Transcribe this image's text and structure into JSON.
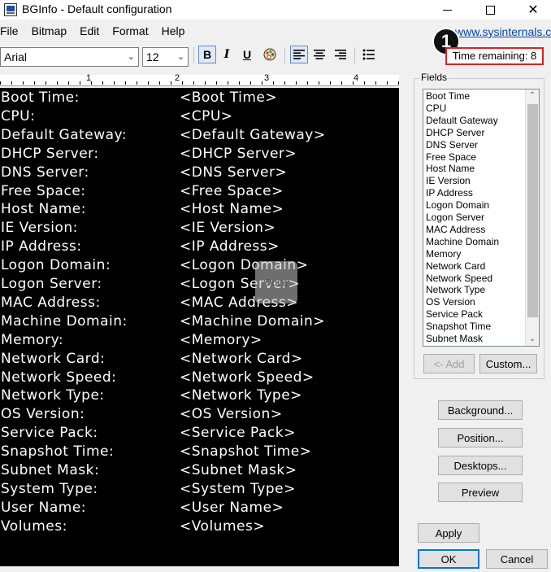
{
  "window": {
    "title": "BGInfo - Default configuration",
    "minimize": "–",
    "maximize": "□",
    "close": "✕"
  },
  "menu": [
    "File",
    "Bitmap",
    "Edit",
    "Format",
    "Help"
  ],
  "link": "www.sysinternals.com",
  "marker": "1",
  "timer": "Time remaining: 8",
  "toolbar": {
    "font": "Arial",
    "size": "12",
    "bold": "B",
    "italic": "𝘐",
    "underline": "U",
    "color": "🎨",
    "align_left": "≡",
    "align_center": "≡",
    "align_right": "≡",
    "bullets": "☰"
  },
  "ruler": [
    "1",
    "2",
    "3",
    "4"
  ],
  "editor_rows": [
    {
      "label": "Boot Time:",
      "value": "<Boot Time>"
    },
    {
      "label": "CPU:",
      "value": "<CPU>"
    },
    {
      "label": "Default Gateway:",
      "value": "<Default Gateway>"
    },
    {
      "label": "DHCP Server:",
      "value": "<DHCP Server>"
    },
    {
      "label": "DNS Server:",
      "value": "<DNS Server>"
    },
    {
      "label": "Free Space:",
      "value": "<Free Space>"
    },
    {
      "label": "Host Name:",
      "value": "<Host Name>"
    },
    {
      "label": "IE Version:",
      "value": "<IE Version>"
    },
    {
      "label": "IP Address:",
      "value": "<IP Address>"
    },
    {
      "label": "Logon Domain:",
      "value": "<Logon Domain>"
    },
    {
      "label": "Logon Server:",
      "value": "<Logon Server>"
    },
    {
      "label": "MAC Address:",
      "value": "<MAC Address>"
    },
    {
      "label": "Machine Domain:",
      "value": "<Machine Domain>"
    },
    {
      "label": "Memory:",
      "value": "<Memory>"
    },
    {
      "label": "Network Card:",
      "value": "<Network Card>"
    },
    {
      "label": "Network Speed:",
      "value": "<Network Speed>"
    },
    {
      "label": "Network Type:",
      "value": "<Network Type>"
    },
    {
      "label": "OS Version:",
      "value": "<OS Version>"
    },
    {
      "label": "Service Pack:",
      "value": "<Service Pack>"
    },
    {
      "label": "Snapshot Time:",
      "value": "<Snapshot Time>"
    },
    {
      "label": "Subnet Mask:",
      "value": "<Subnet Mask>"
    },
    {
      "label": "System Type:",
      "value": "<System Type>"
    },
    {
      "label": "User Name:",
      "value": "<User Name>"
    },
    {
      "label": "Volumes:",
      "value": "<Volumes>"
    }
  ],
  "watermark": "Dove",
  "fields": {
    "title": "Fields",
    "items": [
      "Boot Time",
      "CPU",
      "Default Gateway",
      "DHCP Server",
      "DNS Server",
      "Free Space",
      "Host Name",
      "IE Version",
      "IP Address",
      "Logon Domain",
      "Logon Server",
      "MAC Address",
      "Machine Domain",
      "Memory",
      "Network Card",
      "Network Speed",
      "Network Type",
      "OS Version",
      "Service Pack",
      "Snapshot Time",
      "Subnet Mask"
    ],
    "add": "<- Add",
    "custom": "Custom..."
  },
  "buttons": {
    "background": "Background...",
    "position": "Position...",
    "desktops": "Desktops...",
    "preview": "Preview",
    "apply": "Apply",
    "ok": "OK",
    "cancel": "Cancel"
  }
}
